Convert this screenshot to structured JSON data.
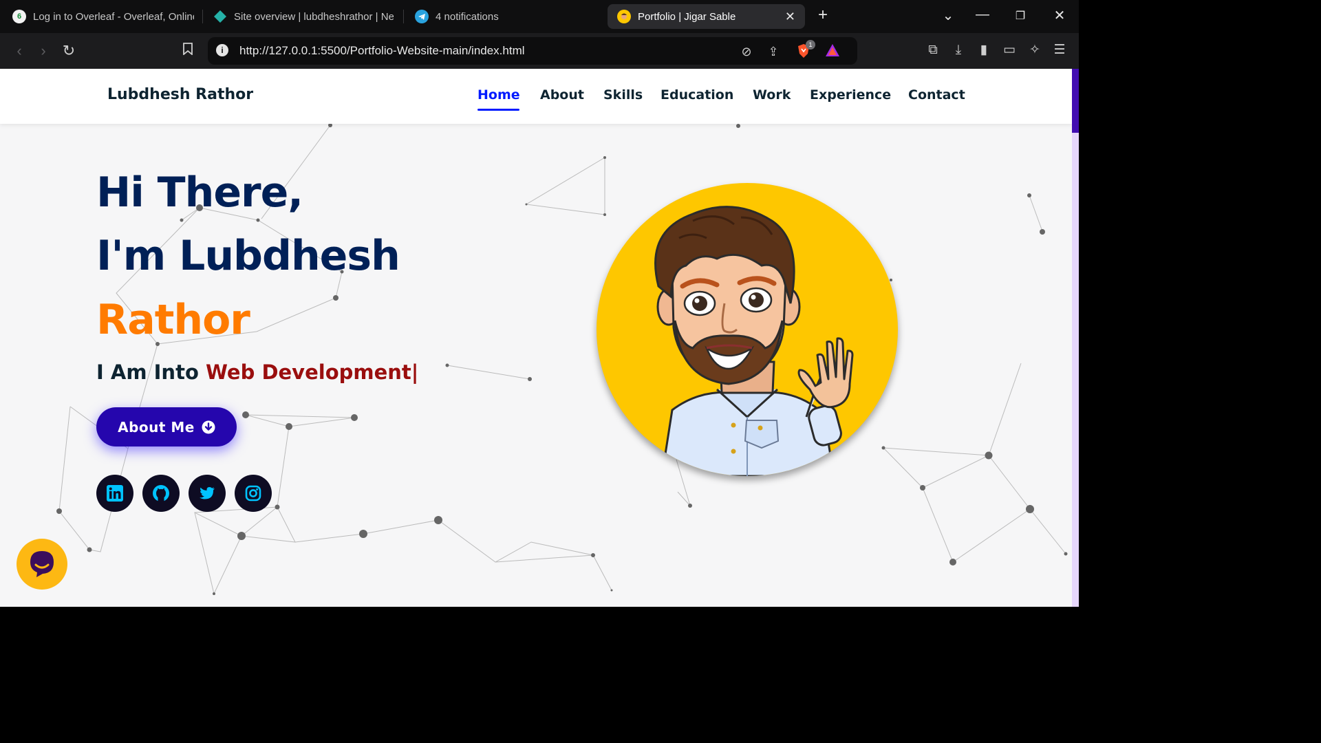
{
  "browser": {
    "tabs": [
      {
        "title": "Log in to Overleaf - Overleaf, Online",
        "icon": "overleaf-icon"
      },
      {
        "title": "Site overview | lubdheshrathor | Net",
        "icon": "netlify-icon"
      },
      {
        "title": "4 notifications",
        "icon": "telegram-icon"
      },
      {
        "title": "Portfolio | Jigar Sable",
        "icon": "avatar-icon",
        "active": true
      }
    ],
    "new_tab": "+",
    "url": "http://127.0.0.1:5500/Portfolio-Website-main/index.html",
    "shields_badge": "1"
  },
  "site": {
    "brand": "Lubdhesh Rathor",
    "nav": [
      "Home",
      "About",
      "Skills",
      "Education",
      "Work",
      "Experience",
      "Contact"
    ],
    "active_nav": "Home",
    "hero": {
      "greeting": "Hi There,",
      "intro": "I'm Lubdhesh",
      "surname": "Rathor",
      "typed_prefix": "I Am Into ",
      "typed_word": "Web Development|",
      "button": "About Me"
    },
    "socials": [
      "linkedin",
      "github",
      "twitter",
      "instagram"
    ]
  },
  "colors": {
    "primary_dark": "#002057",
    "accent_orange": "#ff7b00",
    "typed_red": "#9a0e0e",
    "button": "#2506ad",
    "active_link": "#011aff",
    "avatar_bg": "#fec700",
    "social_bg": "#0e0c23",
    "social_icon": "#00c3ff"
  }
}
